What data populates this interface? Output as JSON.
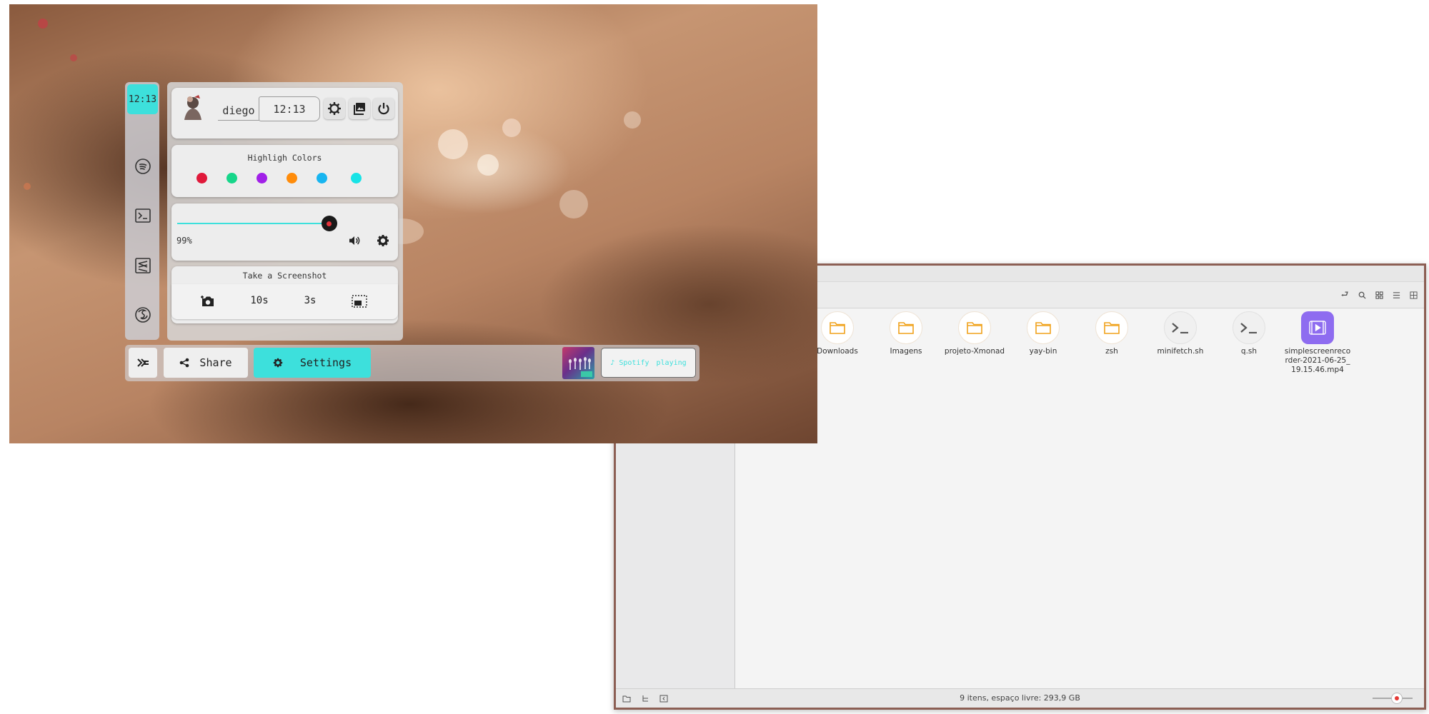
{
  "desktop": {
    "clock": "12:13"
  },
  "profile": {
    "username": "diego",
    "time": "12:13"
  },
  "highlight": {
    "title": "Highligh Colors",
    "colors": [
      "#e0193a",
      "#17d68a",
      "#a120e8",
      "#ff8c0a",
      "#18b5f0",
      "#18e3e6"
    ]
  },
  "volume": {
    "level_text": "99%",
    "level": 0.99,
    "accent": "#3de0dc"
  },
  "screenshot": {
    "title": "Take a Screenshot",
    "delay_10": "10s",
    "delay_3": "3s"
  },
  "bottombar": {
    "share_label": "Share",
    "settings_label": "Settings",
    "spotify_label": "Spotify",
    "spotify_status": "playing",
    "accent": "#3de0dc"
  },
  "file_manager": {
    "files": [
      {
        "name": "Downloads",
        "type": "folder"
      },
      {
        "name": "Imagens",
        "type": "folder"
      },
      {
        "name": "projeto-Xmonad",
        "type": "folder"
      },
      {
        "name": "yay-bin",
        "type": "folder"
      },
      {
        "name": "zsh",
        "type": "folder"
      },
      {
        "name": "minifetch.sh",
        "type": "script"
      },
      {
        "name": "q.sh",
        "type": "script"
      },
      {
        "name": "simplescreenrecorder-2021-06-25_19.15.46.mp4",
        "type": "video"
      }
    ],
    "status_text": "9 itens, espaço livre: 293,9 GB",
    "folder_color": "#f0a21c",
    "video_color": "#8e6cf0"
  }
}
